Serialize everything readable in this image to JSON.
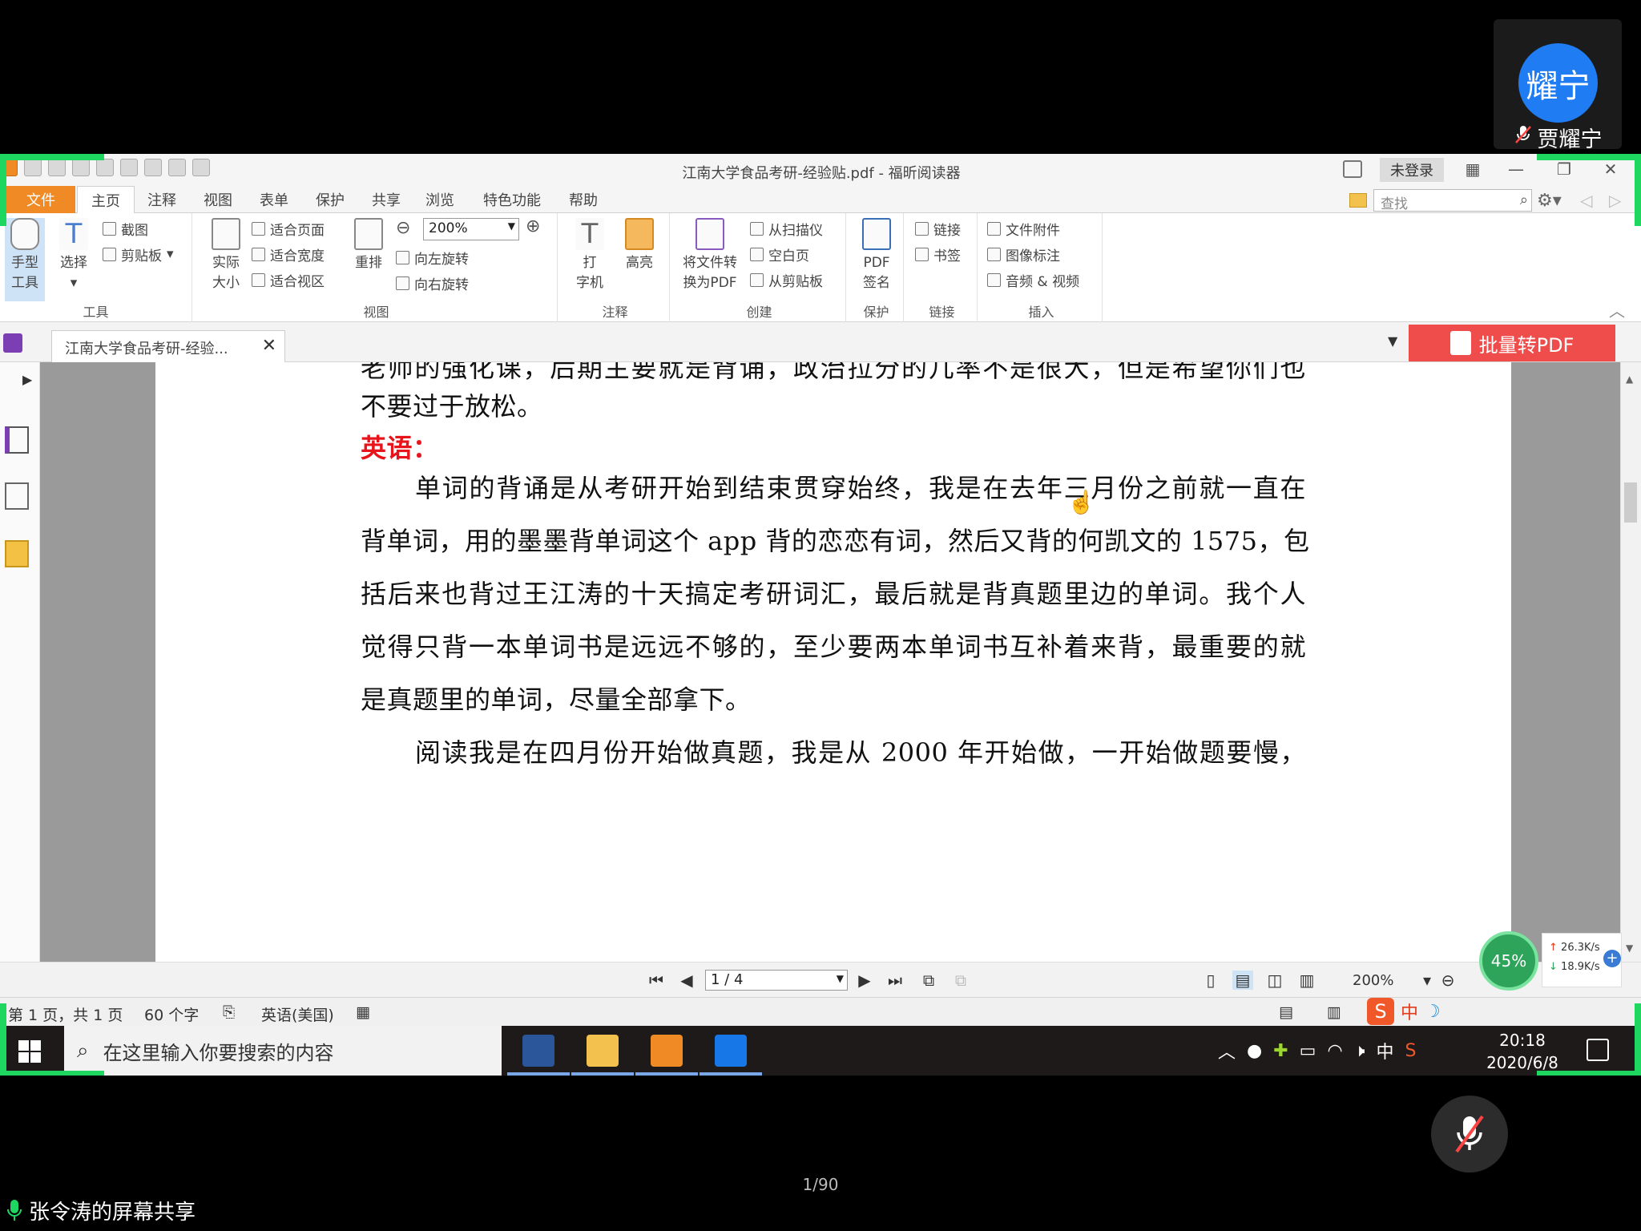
{
  "meeting": {
    "participant": {
      "avatar_text": "耀宁",
      "name": "贾耀宁"
    },
    "page_counter": "1/90",
    "share_label": "张令涛的屏幕共享"
  },
  "app": {
    "window_title": "江南大学食品考研-经验贴.pdf - 福昕阅读器",
    "login_label": "未登录",
    "menu": [
      "文件",
      "主页",
      "注释",
      "视图",
      "表单",
      "保护",
      "共享",
      "浏览",
      "特色功能",
      "帮助"
    ],
    "search_placeholder": "查找",
    "ribbon": {
      "tools": {
        "label": "工具",
        "hand": "手型\n工具",
        "select": "选择",
        "snapshot": "截图",
        "clipboard": "剪贴板"
      },
      "view": {
        "label": "视图",
        "actual_size": "实际\n大小",
        "fit_page": "适合页面",
        "fit_width": "适合宽度",
        "fit_visible": "适合视区",
        "reflow": "重排",
        "zoom": "200%",
        "rotate_left": "向左旋转",
        "rotate_right": "向右旋转"
      },
      "comment": {
        "label": "注释",
        "typewriter": "打\n字机",
        "highlight": "高亮"
      },
      "create": {
        "label": "创建",
        "convert": "将文件转\n换为PDF",
        "from_scanner": "从扫描仪",
        "blank_page": "空白页",
        "from_clipboard": "从剪贴板"
      },
      "protect": {
        "label": "保护",
        "sign": "PDF\n签名"
      },
      "links": {
        "label": "链接",
        "link": "链接",
        "bookmark": "书签"
      },
      "insert": {
        "label": "插入",
        "attachment": "文件附件",
        "image_annot": "图像标注",
        "audio_video": "音频 & 视频"
      }
    },
    "doc_tab_title": "江南大学食品考研-经验...",
    "batch_convert_label": "批量转PDF",
    "document": {
      "partial_top_line": "老师的强化课，后期主要就是背诵，政治拉分的几率不是很大，但是希望你们也",
      "lines": [
        "不要过于放松。",
        "英语：",
        "单词的背诵是从考研开始到结束贯穿始终，我是在去年三月份之前就一直在",
        "背单词，用的墨墨背单词这个 app 背的恋恋有词，然后又背的何凯文的 1575，包",
        "括后来也背过王江涛的十天搞定考研词汇，最后就是背真题里边的单词。我个人",
        "觉得只背一本单词书是远远不够的，至少要两本单词书互补着来背，最重要的就",
        "是真题里的单词，尽量全部拿下。",
        "阅读我是在四月份开始做真题，我是从 2000 年开始做，一开始做题要慢，"
      ]
    },
    "nav": {
      "page_field": "1 / 4",
      "zoom": "200%"
    },
    "status": {
      "page_info": "第 1 页，共 1 页",
      "word_count": "60 个字",
      "language": "英语(美国)"
    },
    "overlay": {
      "progress": "45%",
      "upload_speed": "26.3K/s",
      "download_speed": "18.9K/s",
      "ime_lang": "中"
    }
  },
  "taskbar": {
    "search_placeholder": "在这里输入你要搜索的内容",
    "tray_lang": "中",
    "time": "20:18",
    "date": "2020/6/8"
  }
}
